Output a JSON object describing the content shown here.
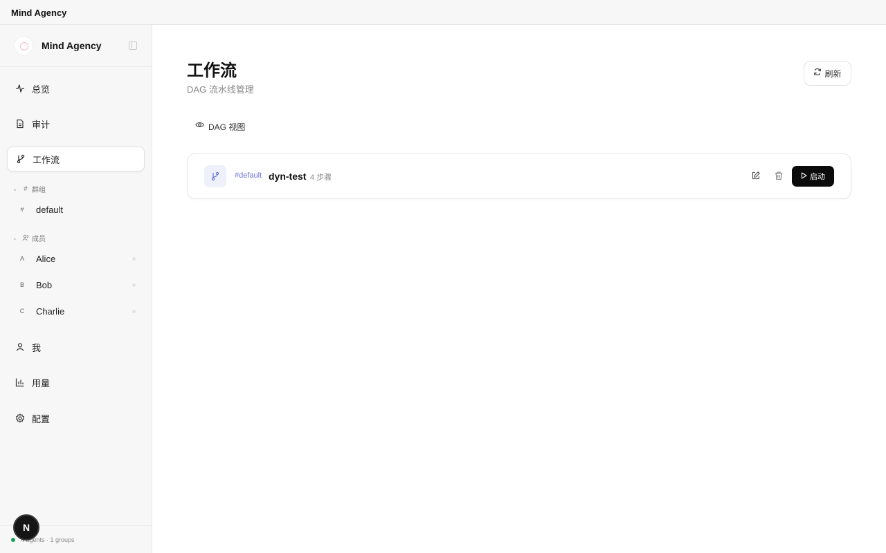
{
  "window": {
    "title": "Mind Agency"
  },
  "sidebar": {
    "brand": "Mind Agency",
    "nav_top": [
      {
        "label": "总览",
        "icon": "activity-icon"
      },
      {
        "label": "审计",
        "icon": "document-icon"
      },
      {
        "label": "工作流",
        "icon": "git-branch-icon",
        "active": true
      }
    ],
    "groups_section": {
      "label": "群组",
      "items": [
        {
          "badge": "#",
          "label": "default"
        }
      ]
    },
    "members_section": {
      "label": "成员",
      "items": [
        {
          "badge": "A",
          "label": "Alice"
        },
        {
          "badge": "B",
          "label": "Bob"
        },
        {
          "badge": "C",
          "label": "Charlie"
        }
      ]
    },
    "nav_bottom": [
      {
        "label": "我",
        "icon": "user-icon"
      },
      {
        "label": "用量",
        "icon": "bar-chart-icon"
      },
      {
        "label": "配置",
        "icon": "gear-icon"
      }
    ],
    "status": "4 agents · 1 groups",
    "avatar_letter": "N"
  },
  "main": {
    "title": "工作流",
    "subtitle": "DAG 流水线管理",
    "refresh_label": "刷新",
    "dag_view_label": "DAG 视图",
    "workflows": [
      {
        "tag": "#default",
        "name": "dyn-test",
        "steps": "4 步骤",
        "start_label": "启动"
      }
    ]
  },
  "colors": {
    "accent": "#6b72d8",
    "status_online": "#1aa05b",
    "primary_button": "#0b0b0b"
  }
}
